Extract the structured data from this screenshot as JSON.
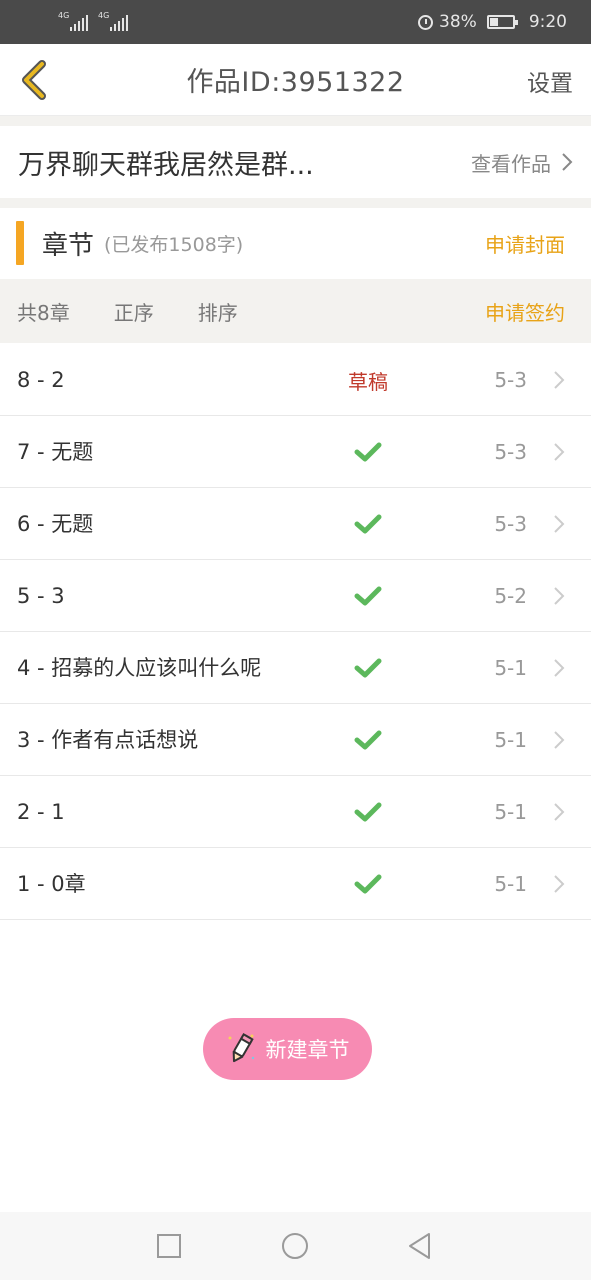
{
  "status_bar": {
    "net1": "4G",
    "net2": "4G",
    "battery": "38%",
    "battery_level": 0.38,
    "time": "9:20",
    "icon_color": "#e6e6e6"
  },
  "header": {
    "title": "作品ID:3951322",
    "settings_label": "设置",
    "back_icon": "chevron-left-icon",
    "back_color": "#e8b820"
  },
  "work": {
    "title": "万界聊天群我居然是群...",
    "view_label": "查看作品"
  },
  "chapter_section": {
    "label": "章节",
    "published": "(已发布1508字)",
    "apply_cover": "申请封面",
    "accent_color": "#f5a623"
  },
  "toolbar": {
    "count": "共8章",
    "order": "正序",
    "sort": "排序",
    "apply_sign": "申请签约"
  },
  "chapters": [
    {
      "title": "8 - 2",
      "status": "草稿",
      "date": "5-3"
    },
    {
      "title": "7 - 无题",
      "status": "published",
      "date": "5-3"
    },
    {
      "title": "6 - 无题",
      "status": "published",
      "date": "5-3"
    },
    {
      "title": "5 - 3",
      "status": "published",
      "date": "5-2"
    },
    {
      "title": "4 - 招募的人应该叫什么呢",
      "status": "published",
      "date": "5-1"
    },
    {
      "title": "3 - 作者有点话想说",
      "status": "published",
      "date": "5-1"
    },
    {
      "title": "2 - 1",
      "status": "published",
      "date": "5-1"
    },
    {
      "title": "1 - 0章",
      "status": "published",
      "date": "5-1"
    }
  ],
  "create_button": {
    "label": "新建章节",
    "color": "#f78bb3"
  },
  "colors": {
    "check": "#5cb85c",
    "draft": "#c0392b",
    "highlight": "#e8a317"
  }
}
